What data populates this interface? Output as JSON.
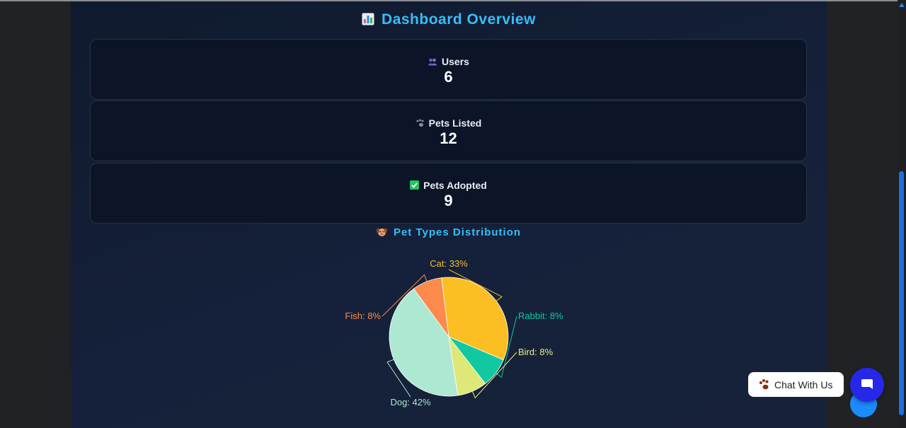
{
  "dashboard": {
    "title": "Dashboard Overview",
    "title_icon": "bar-chart-icon"
  },
  "stats": [
    {
      "label": "Users",
      "value": "6",
      "icon": "users-icon"
    },
    {
      "label": "Pets Listed",
      "value": "12",
      "icon": "paw-icon"
    },
    {
      "label": "Pets Adopted",
      "value": "9",
      "icon": "check-box-icon"
    }
  ],
  "chart_section": {
    "title": "Pet Types Distribution",
    "title_icon": "dog-face-icon"
  },
  "chart_data": {
    "type": "pie",
    "title": "Pet Types Distribution",
    "slices": [
      {
        "name": "Cat",
        "label": "Cat: 33%",
        "value": 33,
        "color": "#fbbf24"
      },
      {
        "name": "Rabbit",
        "label": "Rabbit: 8%",
        "value": 8,
        "color": "#10c9a0"
      },
      {
        "name": "Bird",
        "label": "Bird: 8%",
        "value": 8,
        "color": "#dde876"
      },
      {
        "name": "Dog",
        "label": "Dog: 42%",
        "value": 42,
        "color": "#ade8d3"
      },
      {
        "name": "Fish",
        "label": "Fish: 8%",
        "value": 8,
        "color": "#fb8a4c"
      }
    ],
    "label_colors": {
      "Cat": "#fbbf24",
      "Rabbit": "#10c9a0",
      "Bird": "#e9ef88",
      "Dog": "#ade8d3",
      "Fish": "#fb8a4c"
    }
  },
  "chat_widget": {
    "label": "Chat With Us",
    "icon": "paw-icon",
    "button_icon": "chat-bubble-icon"
  },
  "colors": {
    "accent": "#38bdf8",
    "chat_button": "#2727e8",
    "card_bg": "#0c1428"
  }
}
